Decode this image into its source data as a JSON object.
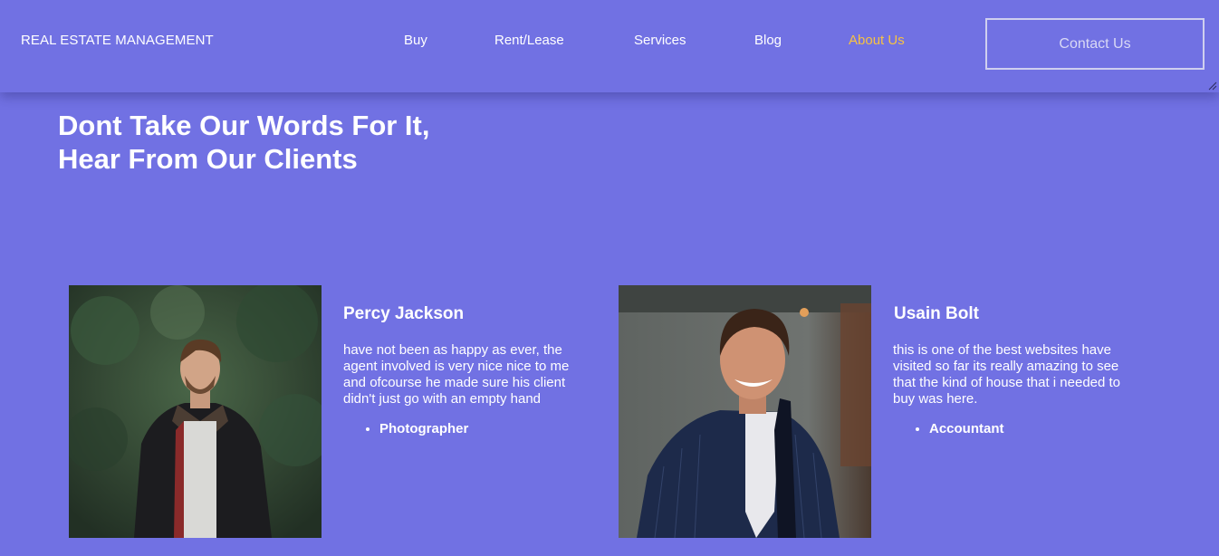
{
  "nav": {
    "brand": "REAL ESTATE MANAGEMENT",
    "links": [
      {
        "label": "Buy"
      },
      {
        "label": "Rent/Lease"
      },
      {
        "label": "Services"
      },
      {
        "label": "Blog"
      },
      {
        "label": "About Us",
        "active": true
      }
    ],
    "contact_label": "Contact Us"
  },
  "section": {
    "heading_line1": "Dont Take Our Words For It,",
    "heading_line2": "Hear From Our Clients"
  },
  "testimonials": [
    {
      "name": "Percy Jackson",
      "text": "have not been as happy as ever, the agent involved is very nice nice to me and ofcourse he made sure his client didn't just go with an empty hand",
      "role": "Photographer",
      "photo": "man-in-leather-jacket-photo"
    },
    {
      "name": "Usain Bolt",
      "text": "this is one of the best websites have visited so far its really amazing to see that the kind of house that i needed to buy was here.",
      "role": "Accountant",
      "photo": "man-in-blue-suit-photo"
    }
  ],
  "colors": {
    "background": "#7171e3",
    "active_link": "#f7c242",
    "text": "#ffffff"
  }
}
